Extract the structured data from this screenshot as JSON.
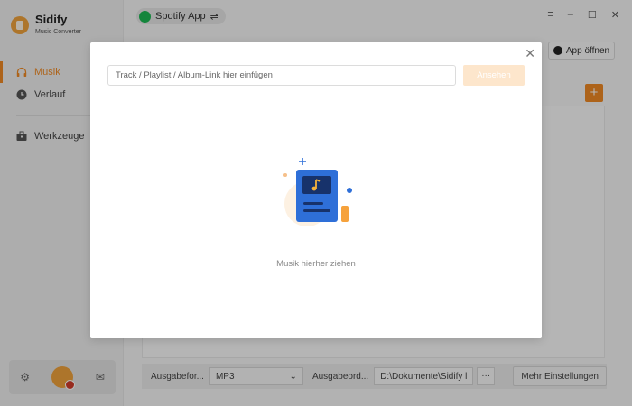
{
  "app": {
    "name": "Sidify",
    "subtitle": "Music Converter",
    "accent_color": "#f08a24"
  },
  "sidebar": {
    "items": [
      {
        "label": "Musik",
        "icon": "headphones-icon",
        "active": true
      },
      {
        "label": "Verlauf",
        "icon": "clock-icon",
        "active": false
      },
      {
        "label": "Werkzeuge",
        "icon": "toolbox-icon",
        "active": false
      }
    ],
    "bottom_icons": [
      "gear-icon",
      "avatar",
      "mail-icon"
    ]
  },
  "topbar": {
    "source_label": "Spotify App",
    "switch_glyph": "⇌",
    "open_app_label": "App öffnen"
  },
  "window_controls": [
    "≡",
    "–",
    "☐",
    "✕"
  ],
  "bottombar": {
    "format_label": "Ausgabefor...",
    "format_value": "MP3",
    "folder_label": "Ausgabeord...",
    "folder_value": "D:\\Dokumente\\Sidify l",
    "browse_label": "···",
    "more_settings_label": "Mehr Einstellungen"
  },
  "modal": {
    "close_glyph": "✕",
    "input_placeholder": "Track / Playlist / Album-Link hier einfügen",
    "add_button_label": "Ansehen",
    "drop_hint": "Musik hierher ziehen"
  }
}
